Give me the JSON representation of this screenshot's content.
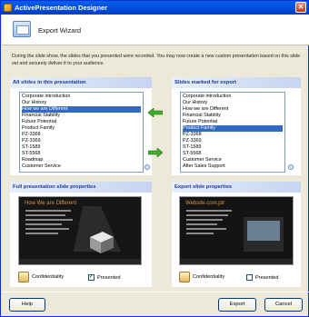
{
  "window": {
    "title": "ActivePresentation Designer"
  },
  "header": {
    "title": "Export Wizard"
  },
  "intro": "During the slide show, the slides that you presented were recorded.  You may now create a new custom presentation based on this slide set and securely deliver it to your audience.",
  "all_slides": {
    "title": "All slides in this presentation",
    "items": [
      "Corporate introduction",
      "Our History",
      "How we are Different",
      "Financial Stability",
      "Future Potential",
      "Product Family",
      "PZ-3368",
      "PZ-3369",
      "ST-1589",
      "ST-5568",
      "Roadmap",
      "Customer Service"
    ]
  },
  "export_slides": {
    "title": "Slides marked for export",
    "items": [
      "Corporate introduction",
      "Our History",
      "How we are Different",
      "Financial Stability",
      "Future Potential",
      "Product Family",
      "PZ-3368",
      "PZ-3369",
      "ST-1589",
      "ST-5568",
      "Customer Service",
      "After Sales Support"
    ]
  },
  "full_props": {
    "title": "Full presentation slide properties",
    "slide_title": "How We are Different",
    "confidentiality": "Confidentiality",
    "presented": "Presented"
  },
  "export_props": {
    "title": "Export slide properties",
    "slide_title": "Website.com.ptr",
    "confidentiality": "Confidentiality",
    "presented": "Presented"
  },
  "buttons": {
    "help": "Help",
    "export": "Export",
    "cancel": "Cancel"
  }
}
